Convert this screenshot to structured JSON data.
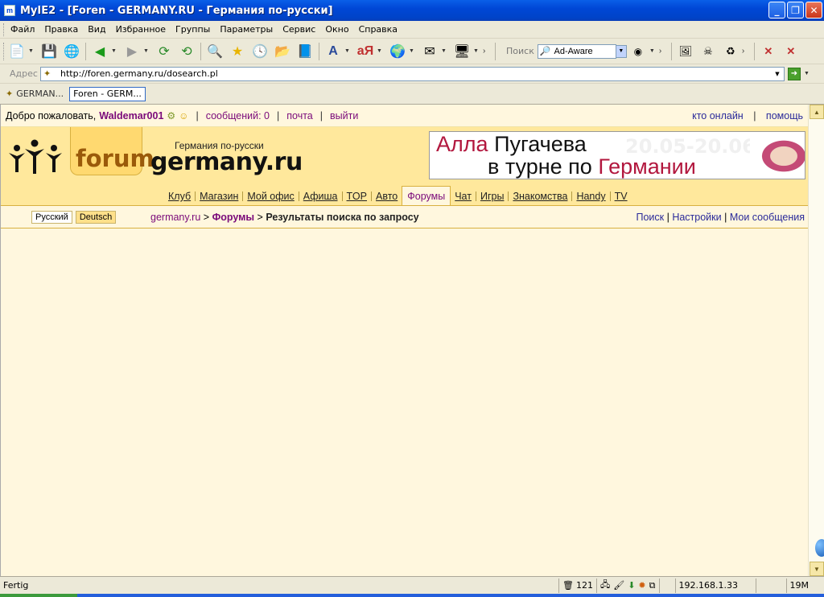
{
  "window": {
    "title": "MyIE2 - [Foren - GERMANY.RU - Германия по-русски]",
    "app_icon": "ie-icon"
  },
  "menu": [
    "Файл",
    "Правка",
    "Вид",
    "Избранное",
    "Группы",
    "Параметры",
    "Сервис",
    "Окно",
    "Справка"
  ],
  "toolbar": {
    "search_label": "Поиск",
    "search_value": "Ad-Aware"
  },
  "address": {
    "label": "Адрес",
    "url": "http://foren.germany.ru/dosearch.pl"
  },
  "tabs": [
    {
      "label": "GERMAN..."
    },
    {
      "label": "Foren - GERM..."
    }
  ],
  "page": {
    "welcome": "Добро пожаловать,",
    "username": "Waldemar001",
    "messages": "сообщений: 0",
    "mail": "почта",
    "logout": "выйти",
    "who_online": "кто онлайн",
    "help": "помощь",
    "logo": {
      "forum": "forum",
      "subtitle": "Германия по-русски",
      "main": "germany.ru"
    },
    "banner": {
      "line1_a": "Алла",
      "line1_b": "Пугачева",
      "dates": "20.05-20.06",
      "line2_a": "в турне по",
      "line2_b": "Германии"
    },
    "nav": [
      "Клуб",
      "Магазин",
      "Мой офис",
      "Афиша",
      "TOP",
      "Авто",
      "Форумы",
      "Чат",
      "Игры",
      "Знакомства",
      "Handy",
      "TV"
    ],
    "nav_active": "Форумы",
    "lang_ru": "Русский",
    "lang_de": "Deutsch",
    "crumb_site": "germany.ru",
    "crumb_sep": ">",
    "crumb_forums": "Форумы",
    "crumb_current": "Результаты поиска по запросу",
    "search_link": "Поиск",
    "settings_link": "Настройки",
    "my_messages_link": "Мои сообщения",
    "sep": "|"
  },
  "status": {
    "text": "Fertig",
    "count": "121",
    "ip": "192.168.1.33",
    "memory": "19M"
  }
}
